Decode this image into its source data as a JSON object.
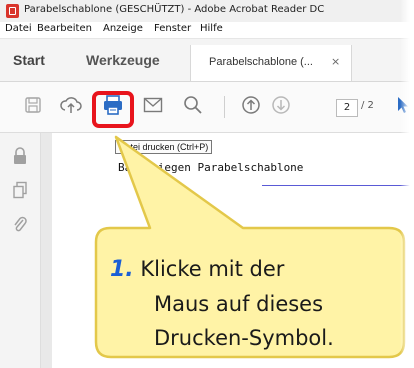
{
  "titlebar": {
    "title": "Parabelschablone (GESCHÜTZT) - Adobe Acrobat Reader DC"
  },
  "menu": [
    "Datei",
    "Bearbeiten",
    "Anzeige",
    "Fenster",
    "Hilfe"
  ],
  "tabs": {
    "home": "Start",
    "tools": "Werkzeuge",
    "document": "Parabelschablone (...",
    "close": "×"
  },
  "toolbar": {
    "icons": [
      "save-icon",
      "upload-icon",
      "print-icon",
      "mail-icon",
      "search-icon",
      "page-up-icon",
      "page-down-icon",
      "select-cursor-icon"
    ],
    "page_current": "2",
    "page_total": "/ 2"
  },
  "tooltip": "Datei drucken (Ctrl+P)",
  "document": {
    "heading": "Bandfliegen Parabelschablone"
  },
  "callout": {
    "number": "1.",
    "line1": "Klicke mit der",
    "line2": "Maus auf dieses",
    "line3": "Drucken-Symbol."
  },
  "colors": {
    "highlight": "#e8141c",
    "callout_fill": "#fff3a6",
    "callout_border": "#e3c84a",
    "number": "#1a5fd6"
  }
}
